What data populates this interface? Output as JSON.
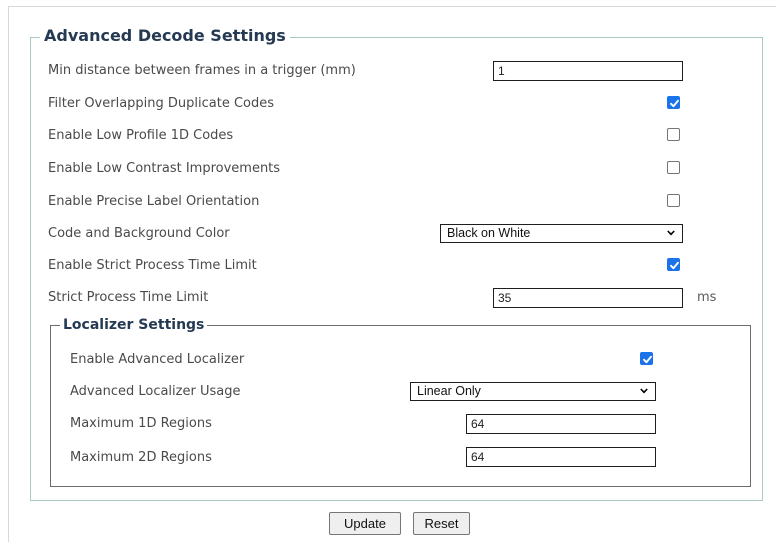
{
  "form": {
    "title": "Advanced Decode Settings",
    "min_distance": {
      "label": "Min distance between frames in a trigger (mm)",
      "value": "1"
    },
    "filter_overlapping": {
      "label": "Filter Overlapping Duplicate Codes",
      "checked": true
    },
    "low_profile_1d": {
      "label": "Enable Low Profile 1D Codes",
      "checked": false
    },
    "low_contrast": {
      "label": "Enable Low Contrast Improvements",
      "checked": false
    },
    "precise_orientation": {
      "label": "Enable Precise Label Orientation",
      "checked": false
    },
    "code_bg_color": {
      "label": "Code and Background Color",
      "value": "Black on White"
    },
    "strict_time_enable": {
      "label": "Enable Strict Process Time Limit",
      "checked": true
    },
    "strict_time_limit": {
      "label": "Strict Process Time Limit",
      "value": "35",
      "unit": "ms"
    }
  },
  "localizer": {
    "title": "Localizer Settings",
    "advanced_enable": {
      "label": "Enable Advanced Localizer",
      "checked": true
    },
    "usage": {
      "label": "Advanced Localizer Usage",
      "value": "Linear Only"
    },
    "max_1d": {
      "label": "Maximum 1D Regions",
      "value": "64"
    },
    "max_2d": {
      "label": "Maximum 2D Regions",
      "value": "64"
    }
  },
  "buttons": {
    "update": "Update",
    "reset": "Reset"
  },
  "colors": {
    "accent": "#1a73e8",
    "legend_text": "#253a52",
    "fieldset_border": "#a9c9c4"
  },
  "icons": {
    "checkbox_checked": "checkmark-icon",
    "select": "chevron-down-icon"
  }
}
